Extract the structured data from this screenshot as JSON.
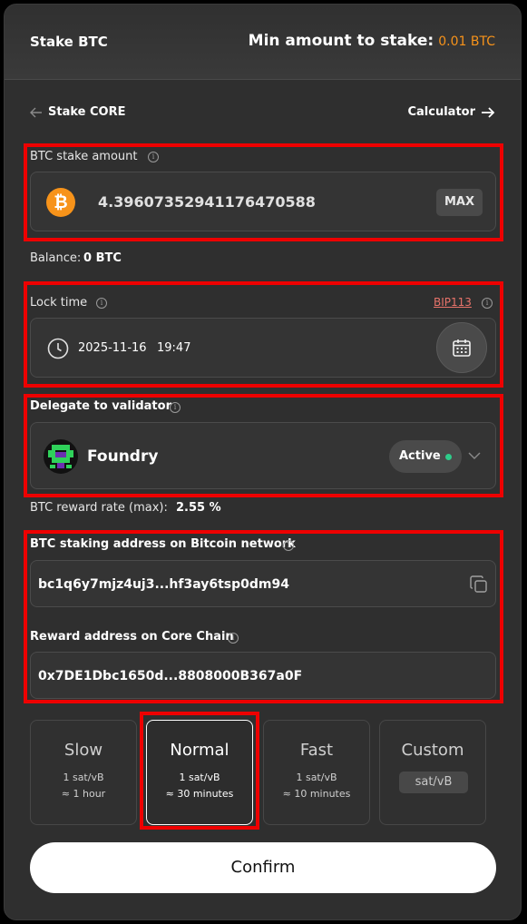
{
  "header": {
    "title": "Stake BTC",
    "min_label": "Min amount to stake:",
    "min_value": "0.01 BTC"
  },
  "nav": {
    "back_label": "Stake CORE",
    "calculator_label": "Calculator"
  },
  "amount": {
    "label": "BTC stake amount",
    "value": "4.39607352941176470588",
    "max_label": "MAX",
    "coin_icon": "bitcoin-icon"
  },
  "balance": {
    "label": "Balance:",
    "value": "0 BTC"
  },
  "lock_time": {
    "label": "Lock time",
    "bip_link": "BIP113",
    "date": "2025-11-16",
    "time": "19:47"
  },
  "validator": {
    "label": "Delegate to validator",
    "name": "Foundry",
    "status": "Active",
    "status_color": "#2ecc8a"
  },
  "reward_rate": {
    "label": "BTC reward rate (max):",
    "value": "2.55 %"
  },
  "staking_address": {
    "label": "BTC staking address on Bitcoin network",
    "value": "bc1q6y7mjz4uj3...hf3ay6tsp0dm94"
  },
  "reward_address": {
    "label": "Reward address on Core Chain",
    "value": "0x7DE1Dbc1650d...8808000B367a0F"
  },
  "fees": [
    {
      "name": "Slow",
      "rate": "1 sat/vB",
      "eta": "≈ 1 hour",
      "selected": false
    },
    {
      "name": "Normal",
      "rate": "1 sat/vB",
      "eta": "≈ 30 minutes",
      "selected": true
    },
    {
      "name": "Fast",
      "rate": "1 sat/vB",
      "eta": "≈ 10 minutes",
      "selected": false
    },
    {
      "name": "Custom",
      "unit_placeholder": "sat/vB",
      "selected": false
    }
  ],
  "confirm_label": "Confirm",
  "colors": {
    "accent_orange": "#f7931a",
    "highlight_red": "#ee0000",
    "bip_link": "#e8736a"
  }
}
